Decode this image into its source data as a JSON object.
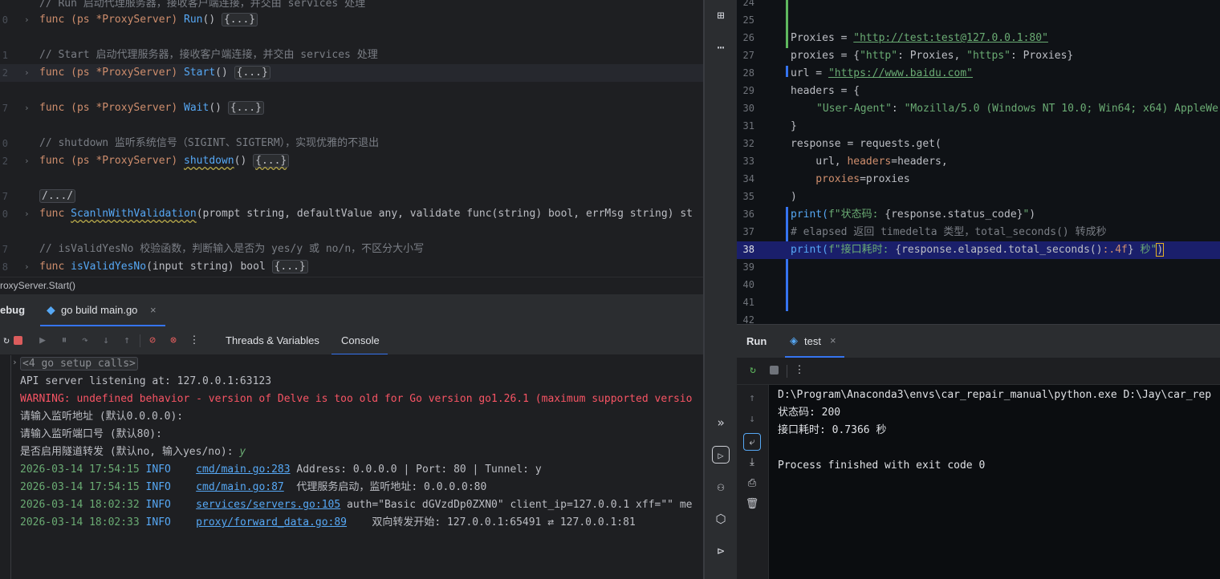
{
  "left_editor": {
    "lines": [
      {
        "num": "",
        "prefix": "// Run ",
        "text": "启动代理服务器，接收客户端连接，并交由 services 处理"
      },
      {
        "num": "0",
        "sig_pre": "func (ps *ProxyServer) ",
        "fn": "Run",
        "sig_post": "() ",
        "fold": "{...}"
      },
      {
        "num": "1",
        "comment": "// Start 启动代理服务器，接收客户端连接，并交由 services 处理"
      },
      {
        "num": "2",
        "sig_pre": "func (ps *ProxyServer) ",
        "fn": "Start",
        "sig_post": "() ",
        "fold": "{...}"
      },
      {
        "num": "7",
        "sig_pre": "func (ps *ProxyServer) ",
        "fn": "Wait",
        "sig_post": "() ",
        "fold": "{...}"
      },
      {
        "num": "0",
        "comment": "// shutdown 监听系统信号（SIGINT、SIGTERM），实现优雅的不退出"
      },
      {
        "num": "2",
        "sig_pre": "func (ps *ProxyServer) ",
        "fn": "shutdown",
        "sig_post": "() ",
        "fold": "{...}"
      },
      {
        "num": "7",
        "fold_comment": "/.../"
      },
      {
        "num": "0",
        "scan_kw": "func ",
        "scan_fn": "ScanlnWithValidation",
        "scan_args": "(prompt string, defaultValue any, validate func(string) bool, errMsg string) st"
      },
      {
        "num": "7",
        "comment": "// isValidYesNo 校验函数，判断输入是否为 yes/y 或 no/n，不区分大小写"
      },
      {
        "num": "8",
        "sig_pre": "func ",
        "fn": "isValidYesNo",
        "sig_post": "(input string) bool ",
        "fold": "{...}"
      }
    ]
  },
  "breadcrumb": "roxyServer.Start()",
  "debug_panel": {
    "title": "ebug",
    "tab_label": "go build main.go",
    "subtabs": [
      "Threads & Variables",
      "Console"
    ]
  },
  "console": {
    "setup_calls": "<4 go setup calls>",
    "api_line": "API server listening at: 127.0.0.1:63123",
    "warning": "WARNING: undefined behavior - version of Delve is too old for Go version go1.26.1 (maximum supported versio",
    "prompt1": "请输入监听地址 (默认0.0.0.0):",
    "prompt2": "请输入监听端口号 (默认80):",
    "prompt3": "是否启用隧道转发 (默认no, 输入yes/no): ",
    "prompt3_answer": "y",
    "logs": [
      {
        "time": "2026-03-14 17:54:15",
        "level": "INFO",
        "src": "cmd/main.go:283",
        "msg": " Address: 0.0.0.0 | Port: 80 | Tunnel: y"
      },
      {
        "time": "2026-03-14 17:54:15",
        "level": "INFO",
        "src": "cmd/main.go:87",
        "msg": "  代理服务启动，监听地址: 0.0.0.0:80"
      },
      {
        "time": "2026-03-14 18:02:32",
        "level": "INFO",
        "src": "services/servers.go:105",
        "msg": " auth=\"Basic dGVzdDp0ZXN0\" client_ip=127.0.0.1 xff=\"\" me"
      },
      {
        "time": "2026-03-14 18:02:33",
        "level": "INFO",
        "src": "proxy/forward_data.go:89",
        "msg": "    双向转发开始: 127.0.0.1:65491 ⇄ 127.0.0.1:81"
      }
    ]
  },
  "right_editor": {
    "line_numbers": [
      "24",
      "25",
      "26",
      "27",
      "28",
      "29",
      "30",
      "31",
      "32",
      "33",
      "34",
      "35",
      "36",
      "37",
      "38",
      "39",
      "40",
      "41",
      "42"
    ],
    "l26_a": "Proxies = ",
    "l26_url": "\"http://test:test@127.0.0.1:80\"",
    "l27_a": "proxies = {",
    "l27_s1": "\"http\"",
    "l27_b": ": Proxies, ",
    "l27_s2": "\"https\"",
    "l27_c": ": Proxies}",
    "l28_a": "url = ",
    "l28_url": "\"https://www.baidu.com\"",
    "l29": "headers = {",
    "l30_s1": "\"User-Agent\"",
    "l30_b": ": ",
    "l30_s2": "\"Mozilla/5.0 (Windows NT 10.0; Win64; x64) AppleWe",
    "l31": "}",
    "l32": "response = requests.get(",
    "l33_a": "    url, ",
    "l33_p": "headers",
    "l33_b": "=headers,",
    "l34_p": "    proxies",
    "l34_b": "=proxies",
    "l35": ")",
    "l36_a": "print(",
    "l36_s": "f\"状态码: ",
    "l36_e": "{response.status_code}",
    "l36_z": "\"",
    "l36_c": ")",
    "l37": "# elapsed 返回 timedelta 类型，total_seconds() 转成秒",
    "l38_a": "print(",
    "l38_s": "f\"接口耗时: ",
    "l38_e": "{response.elapsed.total_seconds()",
    "l38_f": ":.4f",
    "l38_e2": "}",
    "l38_z": " 秒\"",
    "l38_c": ")"
  },
  "run_panel": {
    "title": "Run",
    "tab_label": "test",
    "output": [
      "D:\\Program\\Anaconda3\\envs\\car_repair_manual\\python.exe D:\\Jay\\car_rep",
      "状态码: 200",
      "接口耗时: 0.7366 秒",
      "",
      "Process finished with exit code 0"
    ]
  },
  "colors": {
    "accent": "#56a8f5",
    "info_green": "#6aab73",
    "warning_red": "#f75464",
    "keyword_orange": "#cf8e6d"
  }
}
